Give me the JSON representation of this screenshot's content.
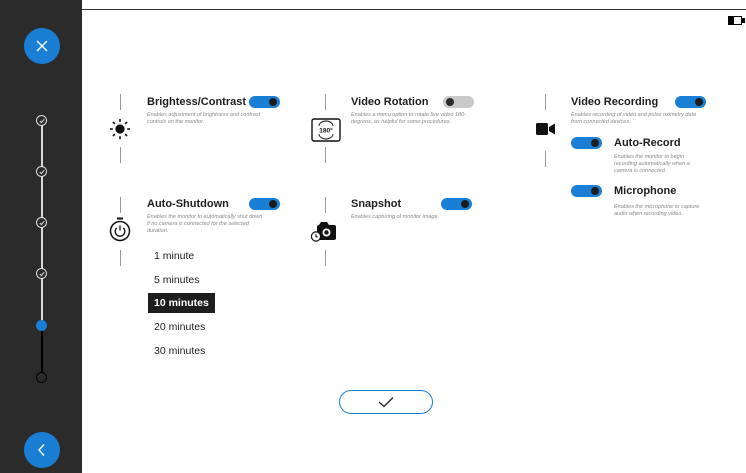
{
  "sidebar": {
    "close_icon": "close-icon",
    "back_icon": "chevron-left-icon",
    "steps": [
      "done",
      "done",
      "done",
      "done",
      "current",
      "pending"
    ]
  },
  "status": {
    "battery_icon": "battery-icon",
    "battery_level": 0.35
  },
  "settings": {
    "brightness": {
      "title": "Brightess/Contrast",
      "description": "Enables adjustment of brightness and contrast controls on the monitor.",
      "enabled": true,
      "icon": "sun-icon"
    },
    "rotation": {
      "title": "Video Rotation",
      "description": "Enables a menu option to rotate live video 180-degrees, as helpful for some procedures.",
      "enabled": false,
      "icon": "rotate-180-icon",
      "icon_label": "180°"
    },
    "recording": {
      "title": "Video Recording",
      "description": "Enables recording of video and pulse oximetry data from connected devices.",
      "enabled": true,
      "icon": "video-camera-icon",
      "auto_record": {
        "title": "Auto-Record",
        "description": "Enables the monitor to begin recording automatically when a camera is connected.",
        "enabled": true
      },
      "microphone": {
        "title": "Microphone",
        "description": "Enables the microphone to capture audio when recording video.",
        "enabled": true
      }
    },
    "shutdown": {
      "title": "Auto-Shutdown",
      "description": "Enables the monitor to automatically shut down if no camera is connected for the selected duration.",
      "enabled": true,
      "icon": "power-timer-icon",
      "options": [
        "1 minute",
        "5 minutes",
        "10 minutes",
        "20 minutes",
        "30 minutes"
      ],
      "selected": "10 minutes"
    },
    "snapshot": {
      "title": "Snapshot",
      "description": "Enables capturing of monitor image.",
      "enabled": true,
      "icon": "camera-timer-icon"
    }
  },
  "confirm_icon": "checkmark-icon",
  "colors": {
    "accent": "#1a7fd4",
    "sidebar": "#2b2b2b",
    "toggle_off": "#c9c9c9"
  }
}
